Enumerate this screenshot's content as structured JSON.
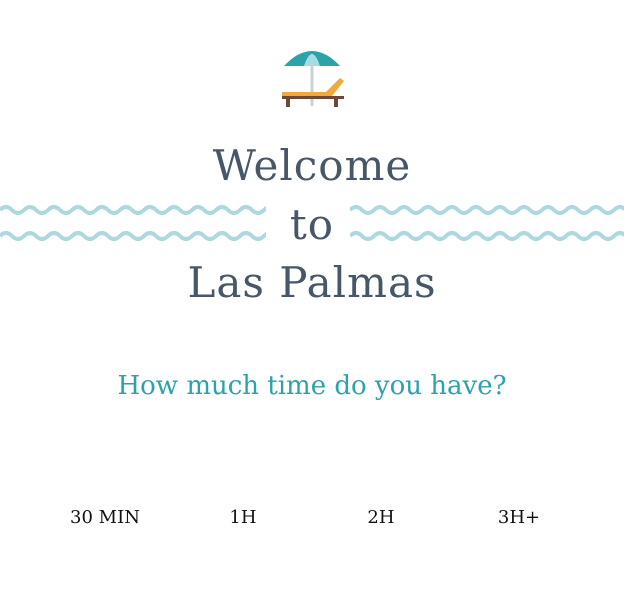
{
  "header": {
    "logo_icon": "beach-umbrella-lounger-icon",
    "decoration_icon": "waves-icon",
    "title_line_1": "Welcome",
    "title_line_2": "to",
    "title_line_3": "Las Palmas"
  },
  "main": {
    "question": "How much time do you have?",
    "options": [
      {
        "label": "30 MIN"
      },
      {
        "label": "1H"
      },
      {
        "label": "2H"
      },
      {
        "label": "3H+"
      }
    ]
  },
  "colors": {
    "title": "#475767",
    "accent": "#2aa3ab",
    "waves": "#add8e0",
    "umbrella": "#2aa3ab",
    "lounger": "#f2a93b",
    "option_text": "#111111",
    "background": "#ffffff"
  }
}
